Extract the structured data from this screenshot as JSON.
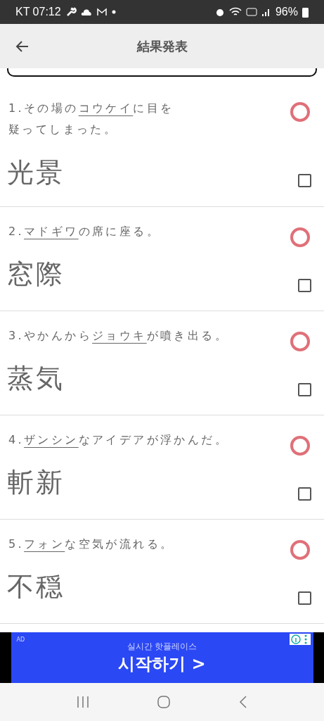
{
  "status_bar": {
    "carrier_time": "KT 07:12",
    "battery": "96%"
  },
  "app_bar": {
    "title": "結果発表"
  },
  "questions": [
    {
      "number": "1.",
      "before": "その場の",
      "underlined": "コウケイ",
      "after": "に目を",
      "next_line": "疑ってしまった。",
      "answer": "光景",
      "kind": "correct",
      "checked": false
    },
    {
      "number": "2.",
      "underlined": "マドギワ",
      "after": "の席に座る。",
      "answer": "窓際",
      "kind": "correct",
      "checked": false
    },
    {
      "number": "3.",
      "before": "やかんから",
      "underlined": "ジョウキ",
      "after": "が噴き出る。",
      "answer": "蒸気",
      "kind": "correct",
      "checked": false
    },
    {
      "number": "4.",
      "underlined": "ザンシン",
      "after": "なアイデアが浮かんだ。",
      "answer": "斬新",
      "kind": "correct",
      "checked": false
    },
    {
      "number": "5.",
      "underlined": "フォン",
      "after": "な空気が流れる。",
      "answer": "不穏",
      "kind": "correct",
      "checked": false
    }
  ],
  "ad": {
    "label": "AD",
    "subtitle": "실시간 핫플레이스",
    "headline": "시작하기 >"
  }
}
